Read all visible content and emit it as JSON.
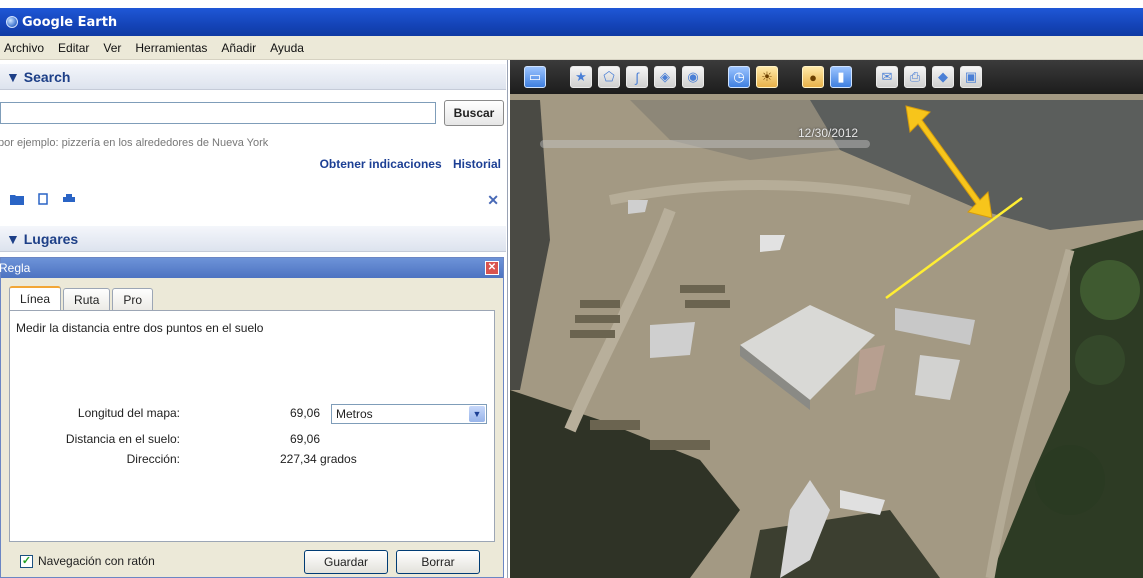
{
  "window": {
    "title": "Google Earth"
  },
  "menu": [
    "Archivo",
    "Editar",
    "Ver",
    "Herramientas",
    "Añadir",
    "Ayuda"
  ],
  "search": {
    "header": "▼ Search",
    "input_value": "",
    "button": "Buscar",
    "hint": "por ejemplo: pizzería en los alrededores de Nueva York",
    "links": [
      "Obtener indicaciones",
      "Historial"
    ]
  },
  "places": {
    "header": "▼ Lugares"
  },
  "ruler": {
    "title": "Regla",
    "tabs": [
      "Línea",
      "Ruta",
      "Pro"
    ],
    "description": "Medir la distancia entre dos puntos en el suelo",
    "map_length_label": "Longitud del mapa:",
    "map_length_value": "69,06",
    "unit": "Metros",
    "ground_distance_label": "Distancia en el suelo:",
    "ground_distance_value": "69,06",
    "heading_label": "Dirección:",
    "heading_value": "227,34 grados",
    "mouse_nav_label": "Navegación con ratón",
    "mouse_nav_checked": true,
    "save_button": "Guardar",
    "clear_button": "Borrar"
  },
  "map": {
    "time_label": "12/30/2012"
  },
  "colors": {
    "title_bar": "#1444b8",
    "menu_bg": "#ece9d8",
    "link": "#1c3f94",
    "measure_line": "#ffee33",
    "arrow": "#f7c51b"
  }
}
